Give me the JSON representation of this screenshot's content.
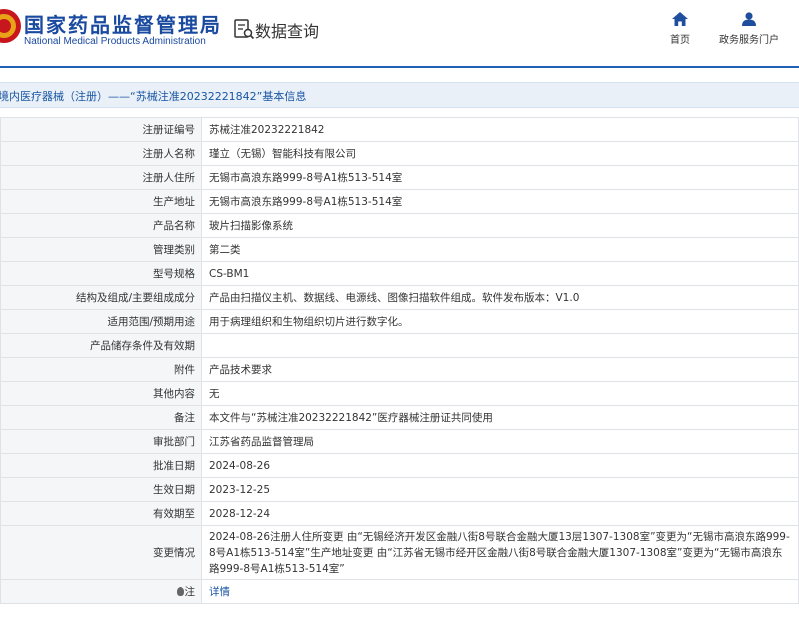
{
  "header": {
    "logo_cn": "国家药品监督管理局",
    "logo_en": "National Medical Products Administration",
    "query_title": "数据查询",
    "nav": {
      "home_label": "首页",
      "portal_label": "政务服务门户"
    }
  },
  "title_bar": {
    "text": "境内医疗器械（注册）——“苏械注准20232221842”基本信息"
  },
  "rows": [
    {
      "label": "注册证编号",
      "value": "苏械注准20232221842"
    },
    {
      "label": "注册人名称",
      "value": "瑾立（无锡）智能科技有限公司"
    },
    {
      "label": "注册人住所",
      "value": "无锡市高浪东路999-8号A1栋513-514室"
    },
    {
      "label": "生产地址",
      "value": "无锡市高浪东路999-8号A1栋513-514室"
    },
    {
      "label": "产品名称",
      "value": "玻片扫描影像系统"
    },
    {
      "label": "管理类别",
      "value": "第二类"
    },
    {
      "label": "型号规格",
      "value": "CS-BM1"
    },
    {
      "label": "结构及组成/主要组成成分",
      "value": "产品由扫描仪主机、数据线、电源线、图像扫描软件组成。软件发布版本：V1.0"
    },
    {
      "label": "适用范围/预期用途",
      "value": "用于病理组织和生物组织切片进行数字化。"
    },
    {
      "label": "产品储存条件及有效期",
      "value": ""
    },
    {
      "label": "附件",
      "value": "产品技术要求"
    },
    {
      "label": "其他内容",
      "value": "无"
    },
    {
      "label": "备注",
      "value": "本文件与“苏械注准20232221842”医疗器械注册证共同使用"
    },
    {
      "label": "审批部门",
      "value": "江苏省药品监督管理局"
    },
    {
      "label": "批准日期",
      "value": "2024-08-26"
    },
    {
      "label": "生效日期",
      "value": "2023-12-25"
    },
    {
      "label": "有效期至",
      "value": "2028-12-24"
    },
    {
      "label": "变更情况",
      "value": "2024-08-26注册人住所变更 由“无锡经济开发区金融八街8号联合金融大厦13层1307-1308室”变更为“无锡市高浪东路999-8号A1栋513-514室”生产地址变更 由“江苏省无锡市经开区金融八街8号联合金融大厦1307-1308室”变更为“无锡市高浪东路999-8号A1栋513-514室”"
    },
    {
      "label": "注",
      "value": "详情"
    }
  ],
  "colors": {
    "brand_blue": "#1a4aa0",
    "header_line": "#1f62b8",
    "title_bar_bg": "#e9f0f8",
    "link": "#1a56a3"
  },
  "icons": {
    "emblem": "national-emblem-icon",
    "query": "query-document-icon",
    "home": "home-icon",
    "portal": "user-icon",
    "note": "bulb-icon"
  }
}
